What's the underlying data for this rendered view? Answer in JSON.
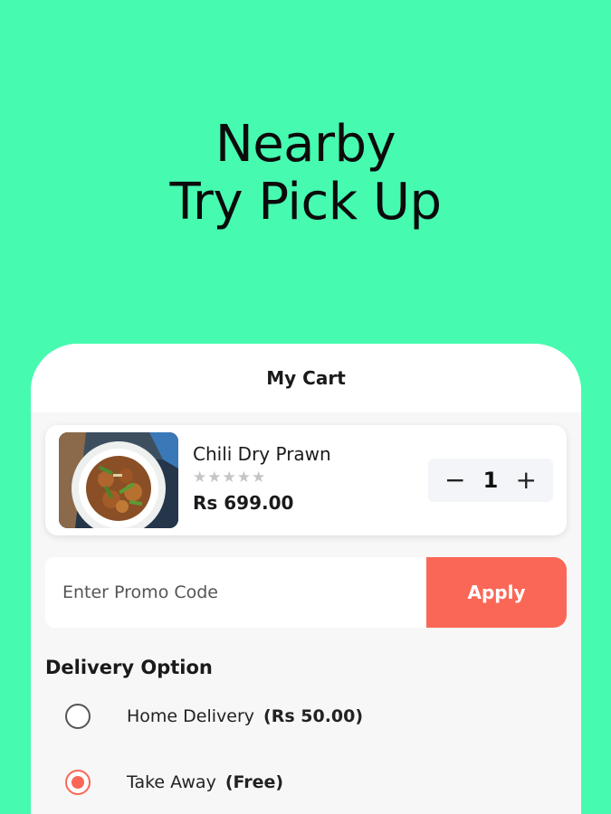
{
  "headline": {
    "line1": "Nearby",
    "line2": "Try Pick Up"
  },
  "cart": {
    "title": "My Cart",
    "items": [
      {
        "name": "Chili Dry Prawn",
        "rating_stars": "★★★★★",
        "rating": 0,
        "price": "Rs 699.00",
        "quantity": "1",
        "minus_symbol": "−",
        "plus_symbol": "+"
      }
    ]
  },
  "promo": {
    "placeholder": "Enter Promo Code",
    "value": "",
    "apply_label": "Apply"
  },
  "delivery": {
    "title": "Delivery Option",
    "options": [
      {
        "label": "Home Delivery",
        "price": "(Rs 50.00)",
        "selected": false
      },
      {
        "label": "Take Away",
        "price": "(Free)",
        "selected": true
      }
    ]
  },
  "colors": {
    "background": "#46fbb0",
    "accent": "#fb6756",
    "card": "#ffffff",
    "surface": "#f7f7f7"
  },
  "icons": {
    "minus": "minus-icon",
    "plus": "plus-icon",
    "star": "star-icon",
    "radio_off": "radio-unchecked-icon",
    "radio_on": "radio-checked-icon"
  }
}
